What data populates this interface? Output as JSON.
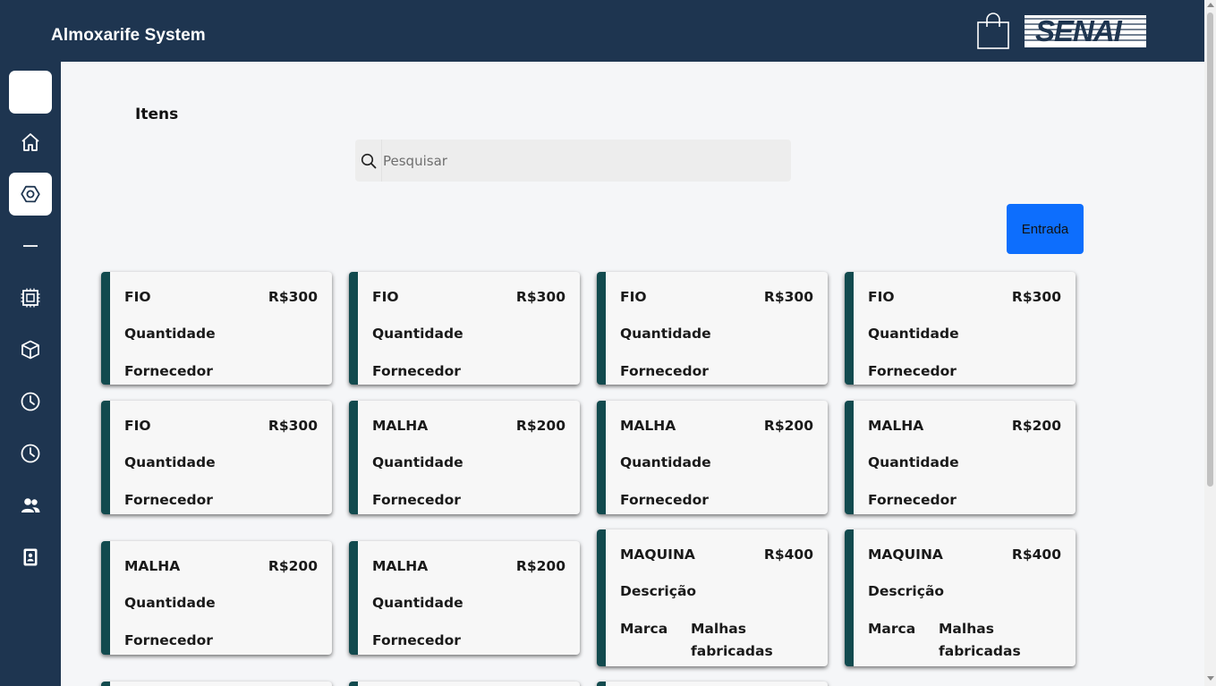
{
  "header": {
    "title": "Almoxarife System",
    "cart_icon": "shopping-bag-icon",
    "logo_text": "SENAI"
  },
  "sidebar": {
    "items": [
      {
        "icon": "blank-icon",
        "active": true
      },
      {
        "icon": "home-icon"
      },
      {
        "icon": "hexagon-nut-icon",
        "active": true
      },
      {
        "icon": "minus-icon"
      },
      {
        "icon": "cpu-icon"
      },
      {
        "icon": "box-icon"
      },
      {
        "icon": "clock-icon"
      },
      {
        "icon": "clock-icon"
      },
      {
        "icon": "people-icon"
      },
      {
        "icon": "device-badge-icon"
      }
    ]
  },
  "main": {
    "title": "Itens",
    "search": {
      "placeholder": "Pesquisar",
      "value": ""
    },
    "entrada_button": "Entrada",
    "cards": [
      {
        "name": "FIO",
        "price": "R$300",
        "line2": "Quantidade",
        "line3": "Fornecedor"
      },
      {
        "name": "FIO",
        "price": "R$300",
        "line2": "Quantidade",
        "line3": "Fornecedor"
      },
      {
        "name": "FIO",
        "price": "R$300",
        "line2": "Quantidade",
        "line3": "Fornecedor"
      },
      {
        "name": "FIO",
        "price": "R$300",
        "line2": "Quantidade",
        "line3": "Fornecedor"
      },
      {
        "name": "FIO",
        "price": "R$300",
        "line2": "Quantidade",
        "line3": "Fornecedor"
      },
      {
        "name": "MALHA",
        "price": "R$200",
        "line2": "Quantidade",
        "line3": "Fornecedor"
      },
      {
        "name": "MALHA",
        "price": "R$200",
        "line2": "Quantidade",
        "line3": "Fornecedor"
      },
      {
        "name": "MALHA",
        "price": "R$200",
        "line2": "Quantidade",
        "line3": "Fornecedor"
      },
      {
        "name": "MALHA",
        "price": "R$200",
        "line2": "Quantidade",
        "line3": "Fornecedor"
      },
      {
        "name": "MALHA",
        "price": "R$200",
        "line2": "Quantidade",
        "line3": "Fornecedor"
      },
      {
        "name": "MAQUINA",
        "price": "R$400",
        "line2": "Descrição",
        "line3": "Marca",
        "line3b": "Malhas fabricadas"
      },
      {
        "name": "MAQUINA",
        "price": "R$400",
        "line2": "Descrição",
        "line3": "Marca",
        "line3b": "Malhas fabricadas"
      }
    ]
  },
  "colors": {
    "header": "#1e3550",
    "card_accent": "#124a4e",
    "primary_button": "#0d6efd"
  }
}
